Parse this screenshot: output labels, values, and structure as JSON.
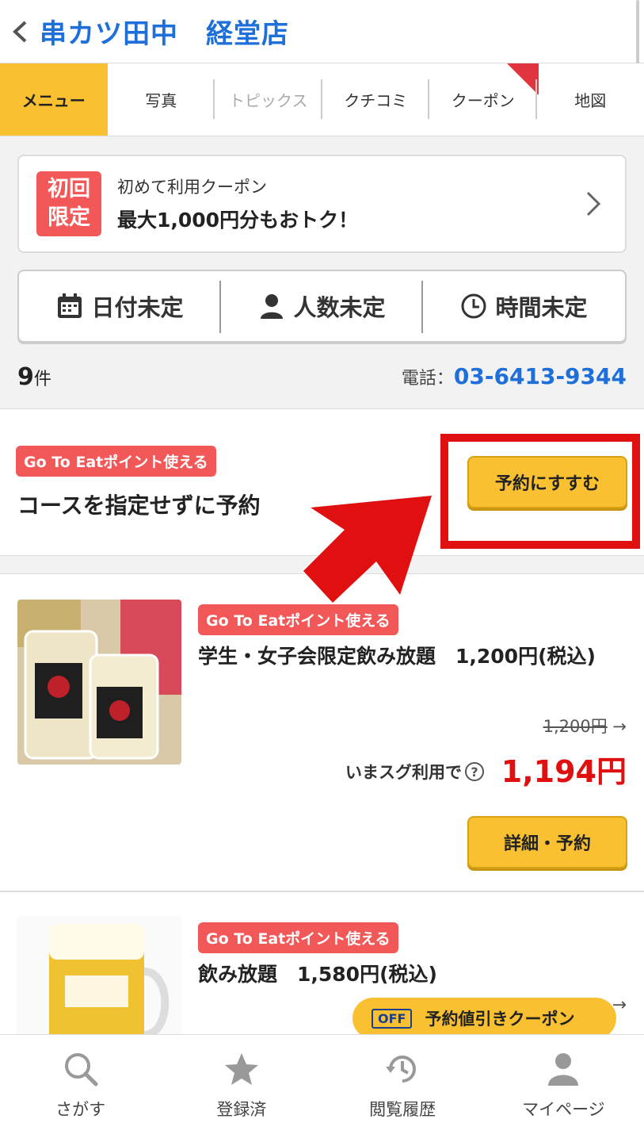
{
  "header": {
    "title": "串カツ田中　経堂店"
  },
  "tabs": [
    {
      "label": "メニュー"
    },
    {
      "label": "写真"
    },
    {
      "label": "トピックス"
    },
    {
      "label": "クチコミ"
    },
    {
      "label": "クーポン"
    },
    {
      "label": "地図"
    }
  ],
  "coupon": {
    "badge_line1": "初回",
    "badge_line2": "限定",
    "small": "初めて利用クーポン",
    "big": "最大1,000円分もおトク！"
  },
  "filters": {
    "date": "日付未定",
    "people": "人数未定",
    "time": "時間未定"
  },
  "count": {
    "number": "9",
    "unit": "件"
  },
  "phone": {
    "label": "電話：",
    "number": "03-6413-9344"
  },
  "no_course": {
    "badge": "Go To Eatポイント使える",
    "title": "コースを指定せずに予約",
    "button": "予約にすすむ"
  },
  "courses": [
    {
      "badge": "Go To Eatポイント使える",
      "title": "学生・女子会限定飲み放題　1,200円(税込)",
      "old_price": "1,200円",
      "now_label": "いまスグ利用で",
      "now_price": "1,194円",
      "button": "詳細・予約"
    },
    {
      "badge": "Go To Eatポイント使える",
      "title": "飲み放題　1,580円(税込)"
    }
  ],
  "floating_coupon": {
    "off": "OFF",
    "label": "予約値引きクーポン"
  },
  "bottom_nav": [
    {
      "label": "さがす",
      "icon": "search-icon"
    },
    {
      "label": "登録済",
      "icon": "star-icon"
    },
    {
      "label": "閲覧履歴",
      "icon": "history-icon"
    },
    {
      "label": "マイページ",
      "icon": "user-icon"
    }
  ],
  "colors": {
    "accent": "#f9c131",
    "link": "#1e6fd9",
    "badge": "#f25858",
    "highlight": "#e01010"
  }
}
